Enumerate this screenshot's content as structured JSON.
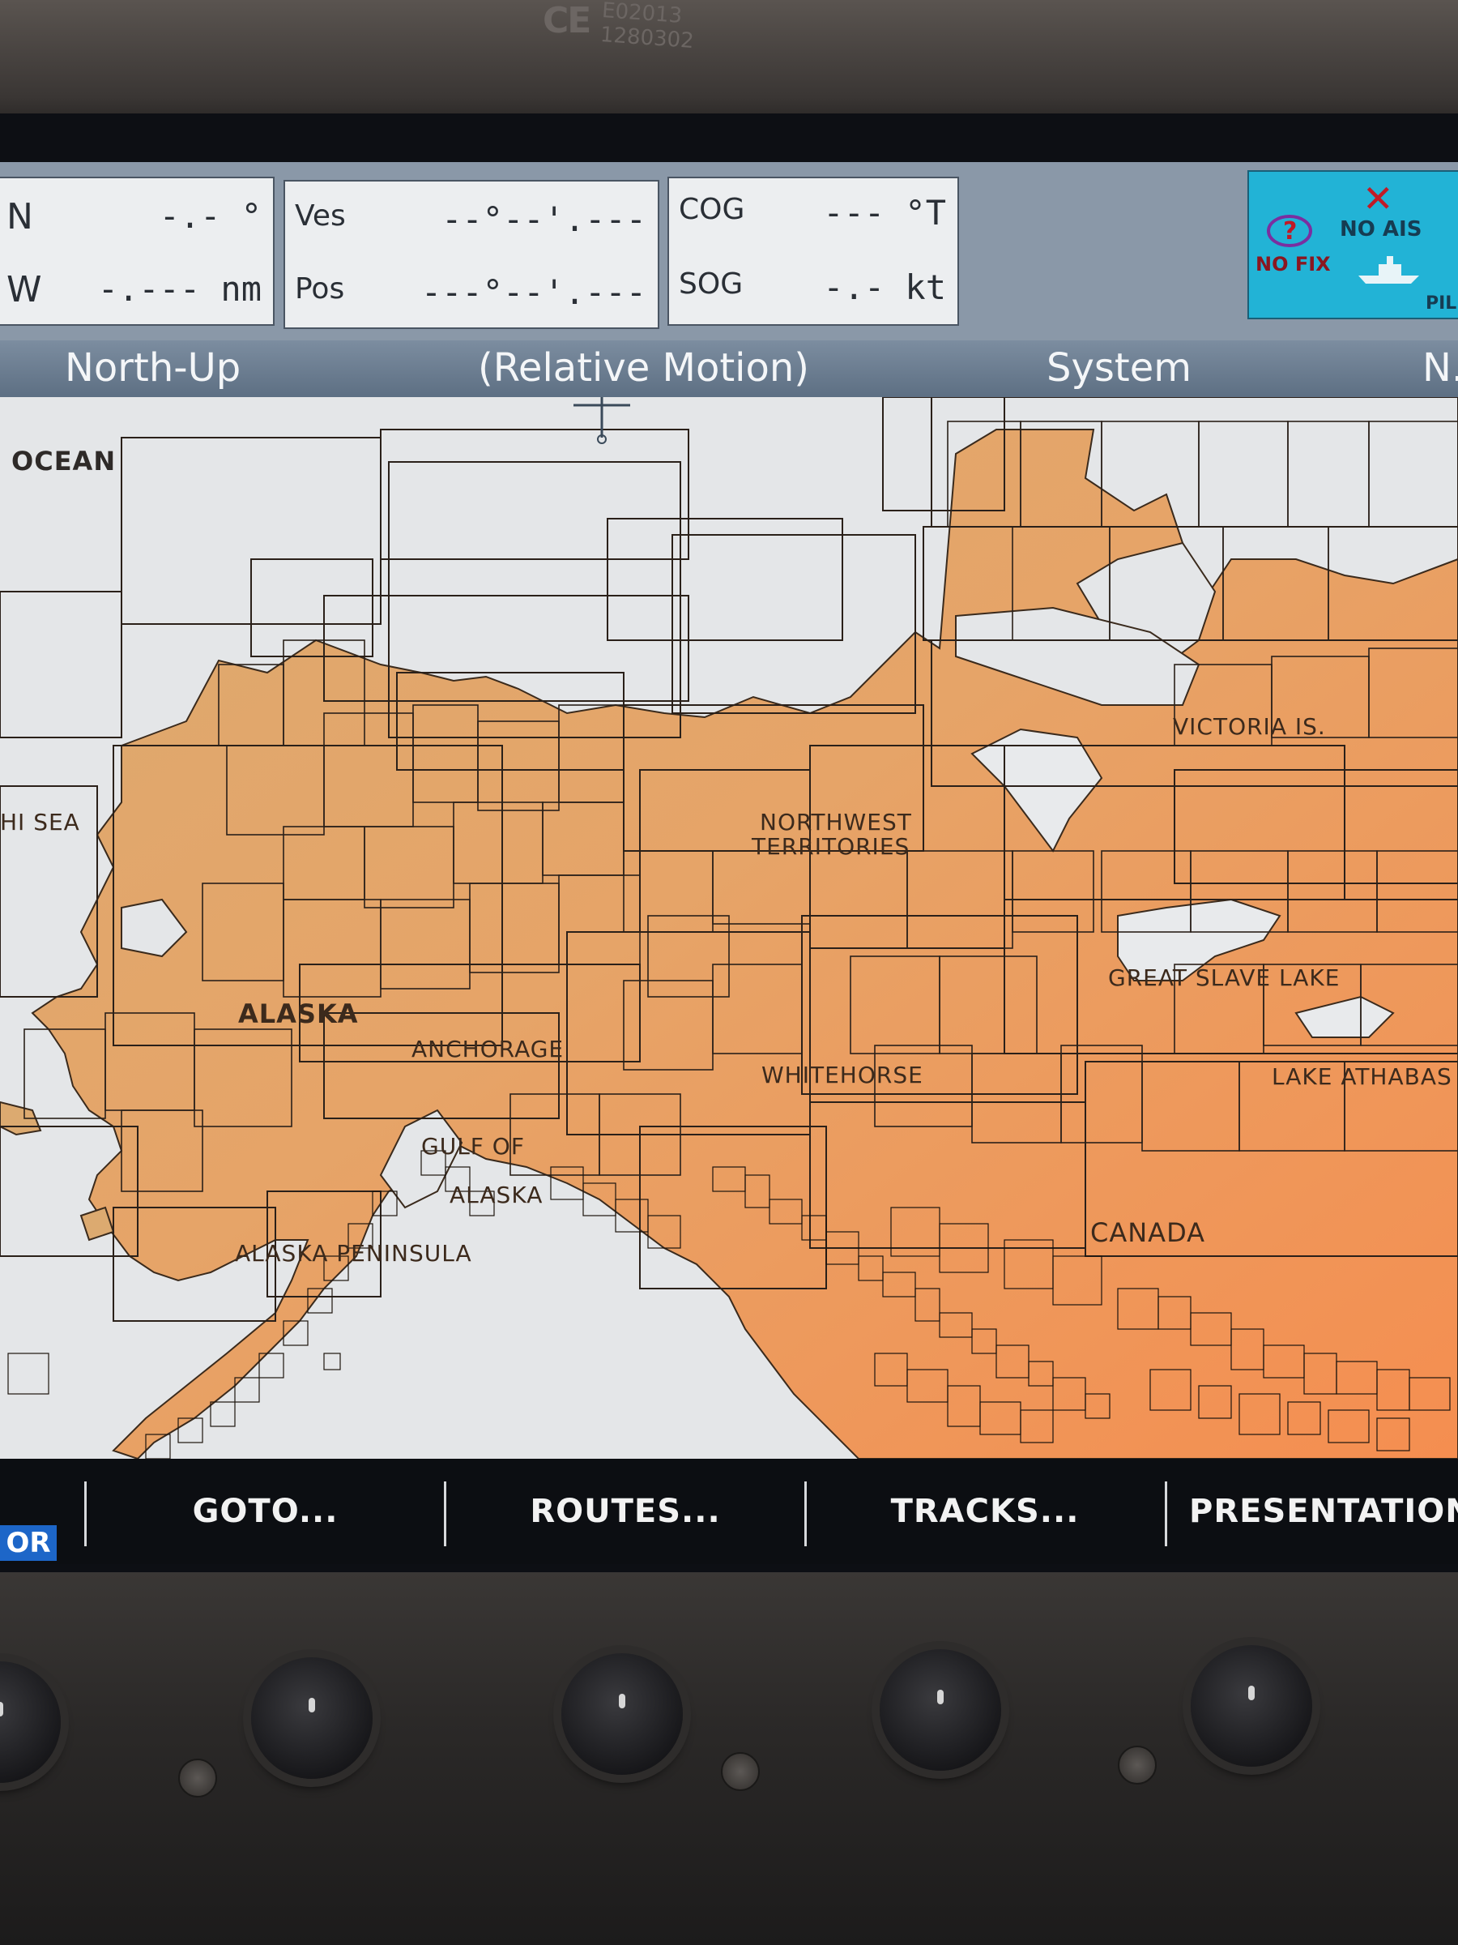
{
  "device": {
    "ce_mark": "CE",
    "ce_code_line1": "E02013",
    "ce_code_line2": "1280302"
  },
  "info_panel": {
    "box1": {
      "row1_label": "N",
      "row1_value": "-.- °",
      "row2_label": "W",
      "row2_value": "-.--- nm"
    },
    "box2": {
      "row1_label": "Ves",
      "row1_value": "--°--'.---",
      "row2_label": "Pos",
      "row2_value": "---°--'.---"
    },
    "box3": {
      "row1_label": "COG",
      "row1_value": "--- °T",
      "row2_label": "SOG",
      "row2_value": "-.- kt"
    }
  },
  "status_icons": {
    "nofix_label": "NO FIX",
    "noais_label": "NO AIS",
    "pilot_label": "PIL",
    "icons": [
      "gps-nofix-icon",
      "ais-disabled-icon",
      "vessel-icon"
    ]
  },
  "mode_bar": {
    "orientation": "North-Up",
    "motion": "(Relative Motion)",
    "system": "System",
    "right_cut": "N."
  },
  "map_labels": {
    "ocean": "OCEAN",
    "sea": "HI SEA",
    "alaska": "ALASKA",
    "anchorage": "ANCHORAGE",
    "gulf_line1": "GULF OF",
    "gulf_line2": "ALASKA",
    "peninsula": "ALASKA PENINSULA",
    "nwt_line1": "NORTHWEST",
    "nwt_line2": "TERRITORIES",
    "victoria": "VICTORIA IS.",
    "great_slave": "GREAT SLAVE LAKE",
    "athabasca": "LAKE ATHABAS",
    "whitehorse": "WHITEHORSE",
    "canada": "CANADA"
  },
  "softkeys": {
    "active_partial": "OR",
    "goto": "GOTO...",
    "routes": "ROUTES...",
    "tracks": "TRACKS...",
    "presentation": "PRESENTATION"
  },
  "colors": {
    "land_alaska": "#dcaa70",
    "land_canada_south": "#f0995a",
    "water": "#e4e6e8",
    "chart_border": "#2a2019",
    "topbar": "#8a98a8",
    "ais_box": "#22b3d6",
    "softkey_bg": "#0c0e12"
  }
}
